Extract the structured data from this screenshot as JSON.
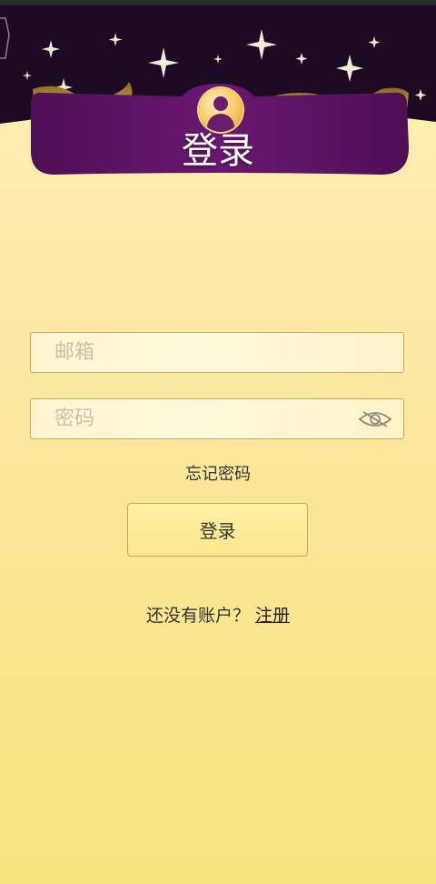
{
  "header": {
    "title": "登录",
    "colors": {
      "banner": "#5b1362",
      "night_sky": "#1c0b22",
      "gold": "#a9862c"
    }
  },
  "form": {
    "email": {
      "placeholder": "邮箱",
      "value": ""
    },
    "password": {
      "placeholder": "密码",
      "value": "",
      "toggle_icon": "eye-off-icon"
    },
    "forgot_label": "忘记密码",
    "login_label": "登录"
  },
  "footer": {
    "prompt": "还没有账户？",
    "register_label": "注册"
  },
  "colors": {
    "background_top": "#fdf0b9",
    "background_bottom": "#f9e27d",
    "field_border": "#c8a768",
    "button_bg": "#fbe78d"
  }
}
